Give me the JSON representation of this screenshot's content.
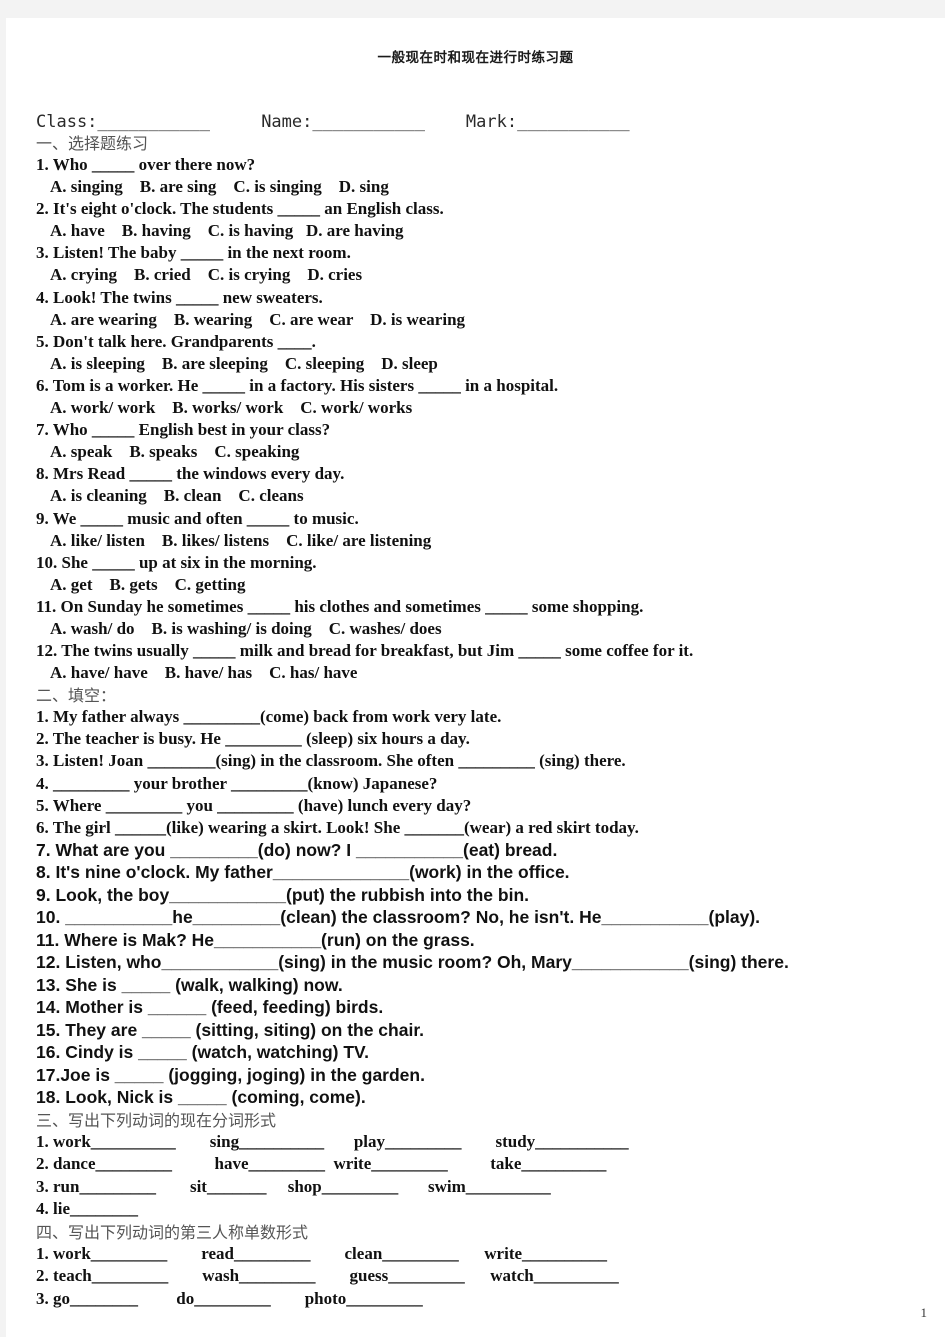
{
  "document": {
    "title": "一般现在时和现在进行时练习题",
    "page_number": "1",
    "meta": {
      "class_label": "Class:___________",
      "name_label": "Name:___________",
      "mark_label": "Mark:___________"
    }
  },
  "section1": {
    "heading": "一、选择题练习",
    "items": [
      {
        "stem": "1. Who _____ over there now?",
        "options": "A. singing    B. are sing    C. is singing    D. sing"
      },
      {
        "stem": "2. It's eight o'clock. The students _____ an English class.",
        "options": "A. have    B. having    C. is having   D. are having"
      },
      {
        "stem": "3. Listen! The baby _____ in the next room.",
        "options": "A. crying    B. cried    C. is crying    D. cries"
      },
      {
        "stem": "4. Look! The twins _____ new sweaters.",
        "options": "A. are wearing    B. wearing    C. are wear    D. is wearing"
      },
      {
        "stem": "5. Don't talk here. Grandparents ____.",
        "options": "A. is sleeping    B. are sleeping    C. sleeping    D. sleep"
      },
      {
        "stem": "6. Tom is a worker. He _____ in a factory. His sisters _____ in a hospital.",
        "options": "A. work/ work    B. works/ work    C. work/ works"
      },
      {
        "stem": "7. Who _____ English best in your class?",
        "options": "A. speak    B. speaks    C. speaking"
      },
      {
        "stem": "8. Mrs Read _____ the windows every day.",
        "options": "A. is cleaning    B. clean    C. cleans"
      },
      {
        "stem": "9. We _____ music and often _____ to music.",
        "options": "A. like/ listen    B. likes/ listens    C. like/ are listening"
      },
      {
        "stem": "10. She _____ up at six in the morning.",
        "options": "A. get    B. gets    C. getting"
      },
      {
        "stem": "11. On Sunday he sometimes _____ his clothes and sometimes _____ some shopping.",
        "options": "A. wash/ do    B. is washing/ is doing    C. washes/ does"
      },
      {
        "stem": "12. The twins usually _____ milk and bread for breakfast, but Jim _____ some coffee for it.",
        "options": "A. have/ have    B. have/ has    C. has/ have"
      }
    ]
  },
  "section2": {
    "heading": "二、填空：",
    "items_serif": [
      "1. My father always _________(come) back from work very late.",
      "2. The teacher is busy. He _________ (sleep) six hours a day.",
      "3. Listen! Joan ________(sing) in the classroom. She often _________ (sing) there.",
      "4. _________ your brother _________(know) Japanese?",
      "5. Where _________ you _________ (have) lunch every day?",
      "6. The girl ______(like) wearing a skirt. Look! She _______(wear) a red skirt today."
    ],
    "items_sans": [
      "7. What are you _________(do) now? I ___________(eat) bread.",
      "8. It's nine o'clock. My father______________(work) in the office.",
      "9. Look, the boy____________(put) the rubbish into the bin.",
      "10. ___________he_________(clean) the classroom? No, he isn't. He___________(play).",
      "11. Where is Mak? He___________(run) on the grass.",
      "12. Listen, who____________(sing) in the music room? Oh, Mary____________(sing) there.",
      "13. She is _____ (walk, walking) now.",
      "14. Mother is ______ (feed, feeding) birds.",
      "15. They are _____ (sitting, siting) on the chair.",
      "16. Cindy is _____ (watch, watching) TV.",
      "17.Joe is _____ (jogging, joging) in the garden.",
      "18. Look, Nick is _____ (coming, come)."
    ]
  },
  "section3": {
    "heading": "三、写出下列动词的现在分词形式",
    "rows": [
      "1. work__________        sing__________       play_________        study___________",
      "2. dance_________          have_________  write_________          take__________",
      "3. run_________        sit_______     shop_________       swim__________",
      "4. lie________"
    ]
  },
  "section4": {
    "heading": "四、写出下列动词的第三人称单数形式",
    "rows": [
      "1. work_________        read_________        clean_________      write__________",
      "2. teach_________        wash_________        guess_________      watch__________",
      "3. go________         do_________        photo_________"
    ]
  }
}
